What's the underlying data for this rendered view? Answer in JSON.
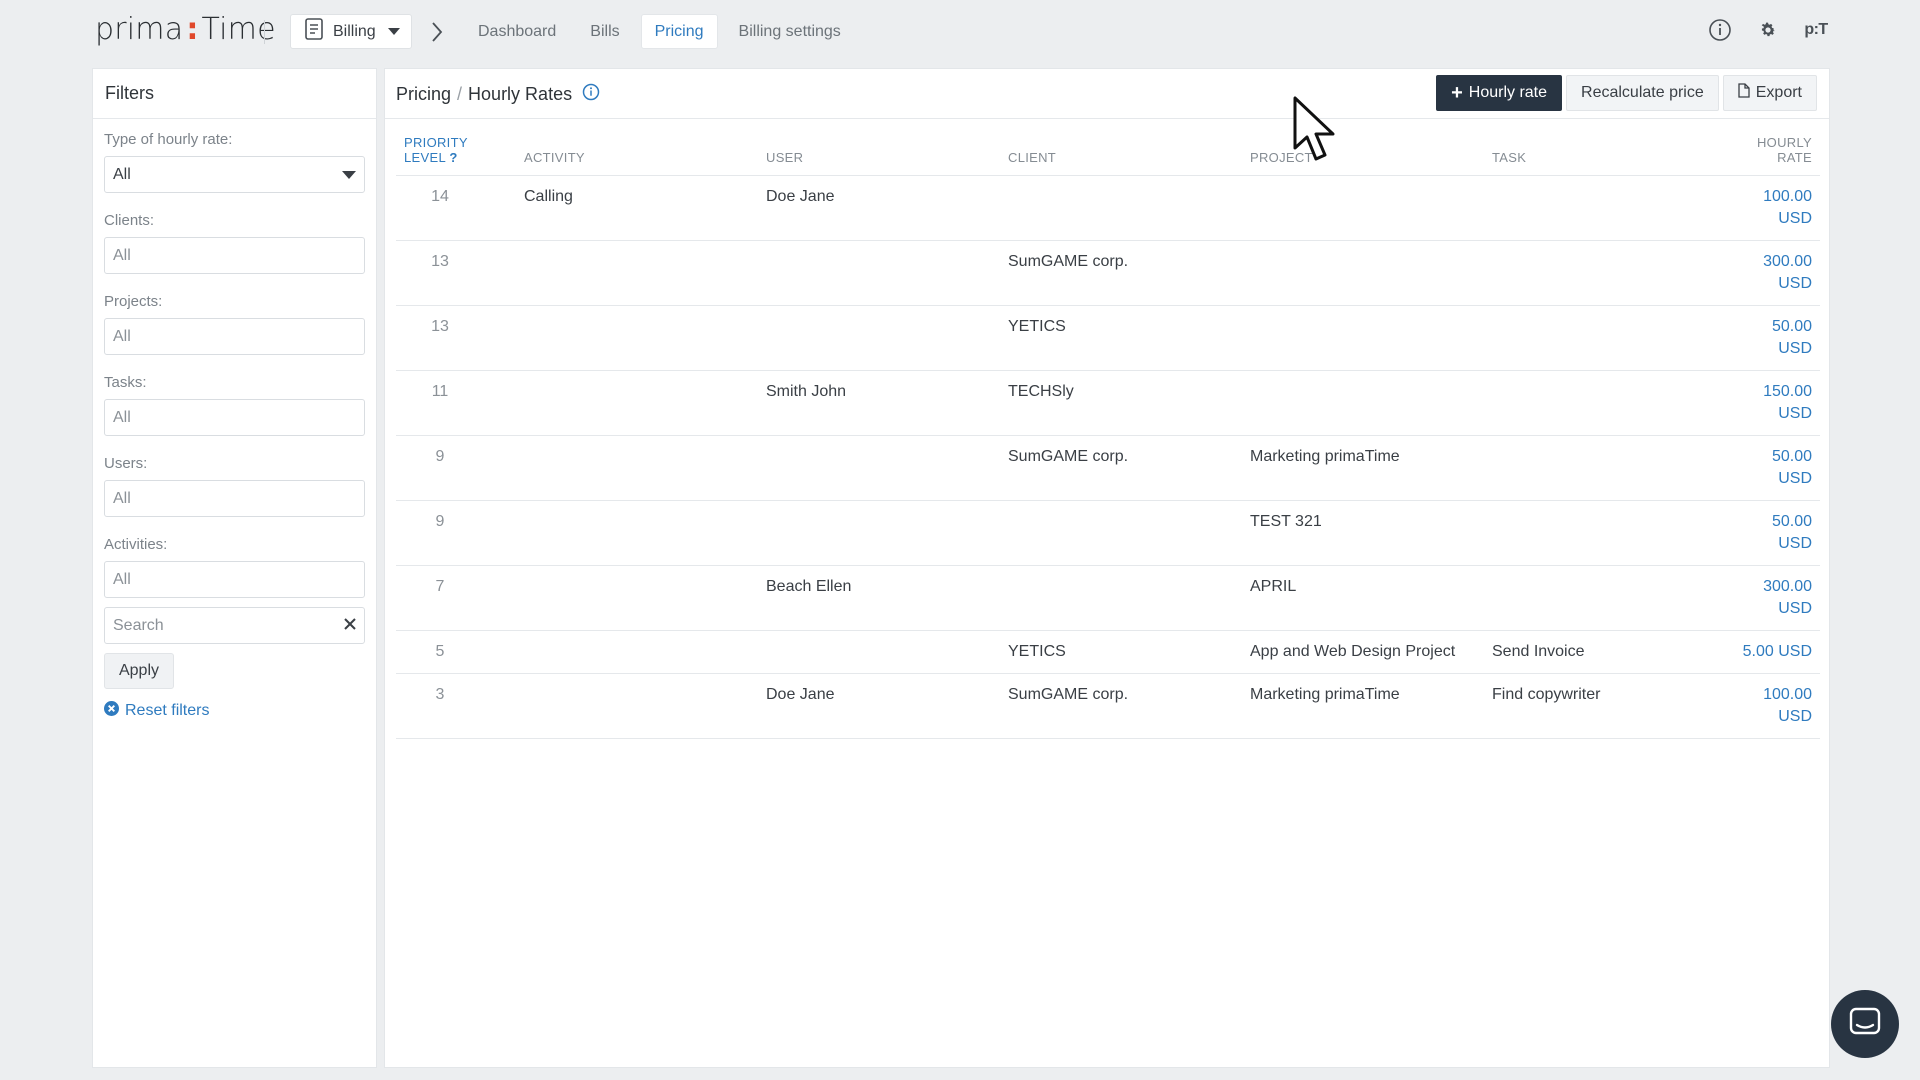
{
  "app": {
    "logo_left": "prima",
    "logo_colon": ":",
    "logo_right": "Time"
  },
  "header": {
    "module": "Billing",
    "nav": [
      "Dashboard",
      "Bills",
      "Pricing",
      "Billing settings"
    ],
    "active_nav": "Pricing",
    "profile_initials": "p:T"
  },
  "filters": {
    "title": "Filters",
    "type_label": "Type of hourly rate:",
    "type_value": "All",
    "clients_label": "Clients:",
    "clients_placeholder": "All",
    "projects_label": "Projects:",
    "projects_placeholder": "All",
    "tasks_label": "Tasks:",
    "tasks_placeholder": "All",
    "users_label": "Users:",
    "users_placeholder": "All",
    "activities_label": "Activities:",
    "activities_placeholder": "All",
    "search_placeholder": "Search",
    "apply_label": "Apply",
    "reset_label": "Reset filters"
  },
  "main": {
    "crumb_root": "Pricing",
    "crumb_current": "Hourly Rates",
    "btn_add": "Hourly rate",
    "btn_recalc": "Recalculate price",
    "btn_export": "Export",
    "columns": {
      "priority_1": "PRIORITY",
      "priority_2": "LEVEL",
      "priority_help": "?",
      "activity": "ACTIVITY",
      "user": "USER",
      "client": "CLIENT",
      "project": "PROJECT",
      "task": "TASK",
      "rate_1": "HOURLY",
      "rate_2": "RATE"
    },
    "rows": [
      {
        "priority": "14",
        "activity": "Calling",
        "user": "Doe Jane",
        "client": "",
        "project": "",
        "task": "",
        "rate": "100.00",
        "currency": "USD"
      },
      {
        "priority": "13",
        "activity": "",
        "user": "",
        "client": "SumGAME corp.",
        "project": "",
        "task": "",
        "rate": "300.00",
        "currency": "USD"
      },
      {
        "priority": "13",
        "activity": "",
        "user": "",
        "client": "YETICS",
        "project": "",
        "task": "",
        "rate": "50.00",
        "currency": "USD"
      },
      {
        "priority": "11",
        "activity": "",
        "user": "Smith John",
        "client": "TECHSly",
        "project": "",
        "task": "",
        "rate": "150.00",
        "currency": "USD"
      },
      {
        "priority": "9",
        "activity": "",
        "user": "",
        "client": "SumGAME corp.",
        "project": "Marketing primaTime",
        "task": "",
        "rate": "50.00",
        "currency": "USD"
      },
      {
        "priority": "9",
        "activity": "",
        "user": "",
        "client": "",
        "project": "TEST 321",
        "task": "",
        "rate": "50.00",
        "currency": "USD"
      },
      {
        "priority": "7",
        "activity": "",
        "user": "Beach Ellen",
        "client": "",
        "project": "APRIL",
        "task": "",
        "rate": "300.00",
        "currency": "USD"
      },
      {
        "priority": "5",
        "activity": "",
        "user": "",
        "client": "YETICS",
        "project": "App and Web Design Project",
        "task": "Send Invoice",
        "rate": "5.00 USD",
        "currency": ""
      },
      {
        "priority": "3",
        "activity": "",
        "user": "Doe Jane",
        "client": "SumGAME corp.",
        "project": "Marketing primaTime",
        "task": "Find copywriter",
        "rate": "100.00",
        "currency": "USD"
      }
    ]
  },
  "icons": {
    "billing": "document-icon",
    "info": "info-icon",
    "settings": "gear-icon",
    "chat": "chat-icon",
    "cursor": "mouse-cursor-icon"
  },
  "colors": {
    "accent": "#2f7bbf",
    "primary_button": "#283442",
    "logo_colon": "#e0482b"
  }
}
